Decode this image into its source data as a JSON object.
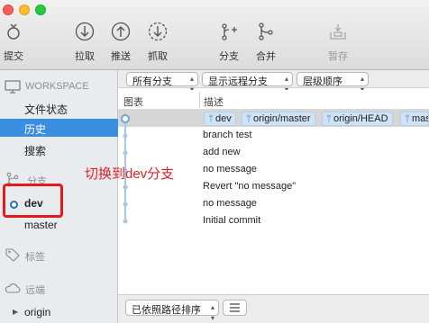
{
  "toolbar": {
    "buttons": [
      {
        "label": "提交",
        "icon": "commit-icon"
      },
      {
        "label": "拉取",
        "icon": "pull-icon"
      },
      {
        "label": "推送",
        "icon": "push-icon"
      },
      {
        "label": "抓取",
        "icon": "fetch-icon"
      },
      {
        "label": "分支",
        "icon": "branch-icon"
      },
      {
        "label": "合并",
        "icon": "merge-icon"
      },
      {
        "label": "暂存",
        "icon": "stash-icon",
        "disabled": true
      }
    ]
  },
  "sidebar": {
    "workspace": {
      "label": "WORKSPACE",
      "icon": "monitor-icon"
    },
    "workspace_items": [
      "文件状态",
      "历史",
      "搜索"
    ],
    "branches": {
      "label": "分支",
      "icon": "branch-icon"
    },
    "branch_items": [
      "dev",
      "master"
    ],
    "tags": {
      "label": "标签",
      "icon": "tag-icon"
    },
    "remotes": {
      "label": "远端",
      "icon": "cloud-icon"
    },
    "remote_items": [
      "origin"
    ]
  },
  "filters": {
    "branch_filter": "所有分支",
    "remote_filter": "显示远程分支",
    "order": "层级顺序"
  },
  "columns": {
    "graph": "图表",
    "description": "描述"
  },
  "commits": [
    {
      "message": "",
      "refs": [
        "dev",
        "origin/master",
        "origin/HEAD",
        "mas"
      ]
    },
    {
      "message": "branch test"
    },
    {
      "message": "add new"
    },
    {
      "message": "no message"
    },
    {
      "message": "Revert \"no message\""
    },
    {
      "message": "no message"
    },
    {
      "message": "Initial commit"
    }
  ],
  "annotation": "切换到dev分支",
  "bottom": {
    "sort": "已依照路径排序"
  },
  "colors": {
    "accent": "#3b8fe0",
    "annotation": "#e0222b",
    "tag": "#cfe3f5"
  }
}
